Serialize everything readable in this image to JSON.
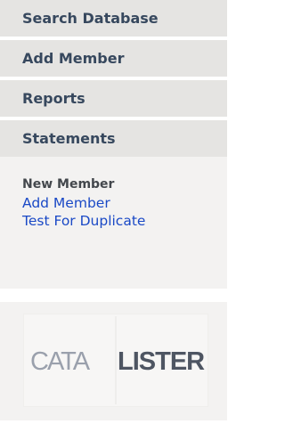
{
  "nav": {
    "items": [
      {
        "label": "Search Database"
      },
      {
        "label": "Add Member"
      },
      {
        "label": "Reports"
      },
      {
        "label": "Statements"
      }
    ]
  },
  "subpanel": {
    "heading": "New Member",
    "links": [
      {
        "label": "Add Member"
      },
      {
        "label": "Test For Duplicate"
      }
    ]
  },
  "logo": {
    "text_left": "CATA",
    "text_right": "LISTER",
    "icon": "catalister-logo"
  },
  "colors": {
    "nav_bg": "#e5e4e2",
    "nav_text": "#37485e",
    "panel_bg": "#f3f2f1",
    "link": "#1a49c6",
    "logo_dark": "#4e5562",
    "logo_light": "#9aa0ac"
  }
}
